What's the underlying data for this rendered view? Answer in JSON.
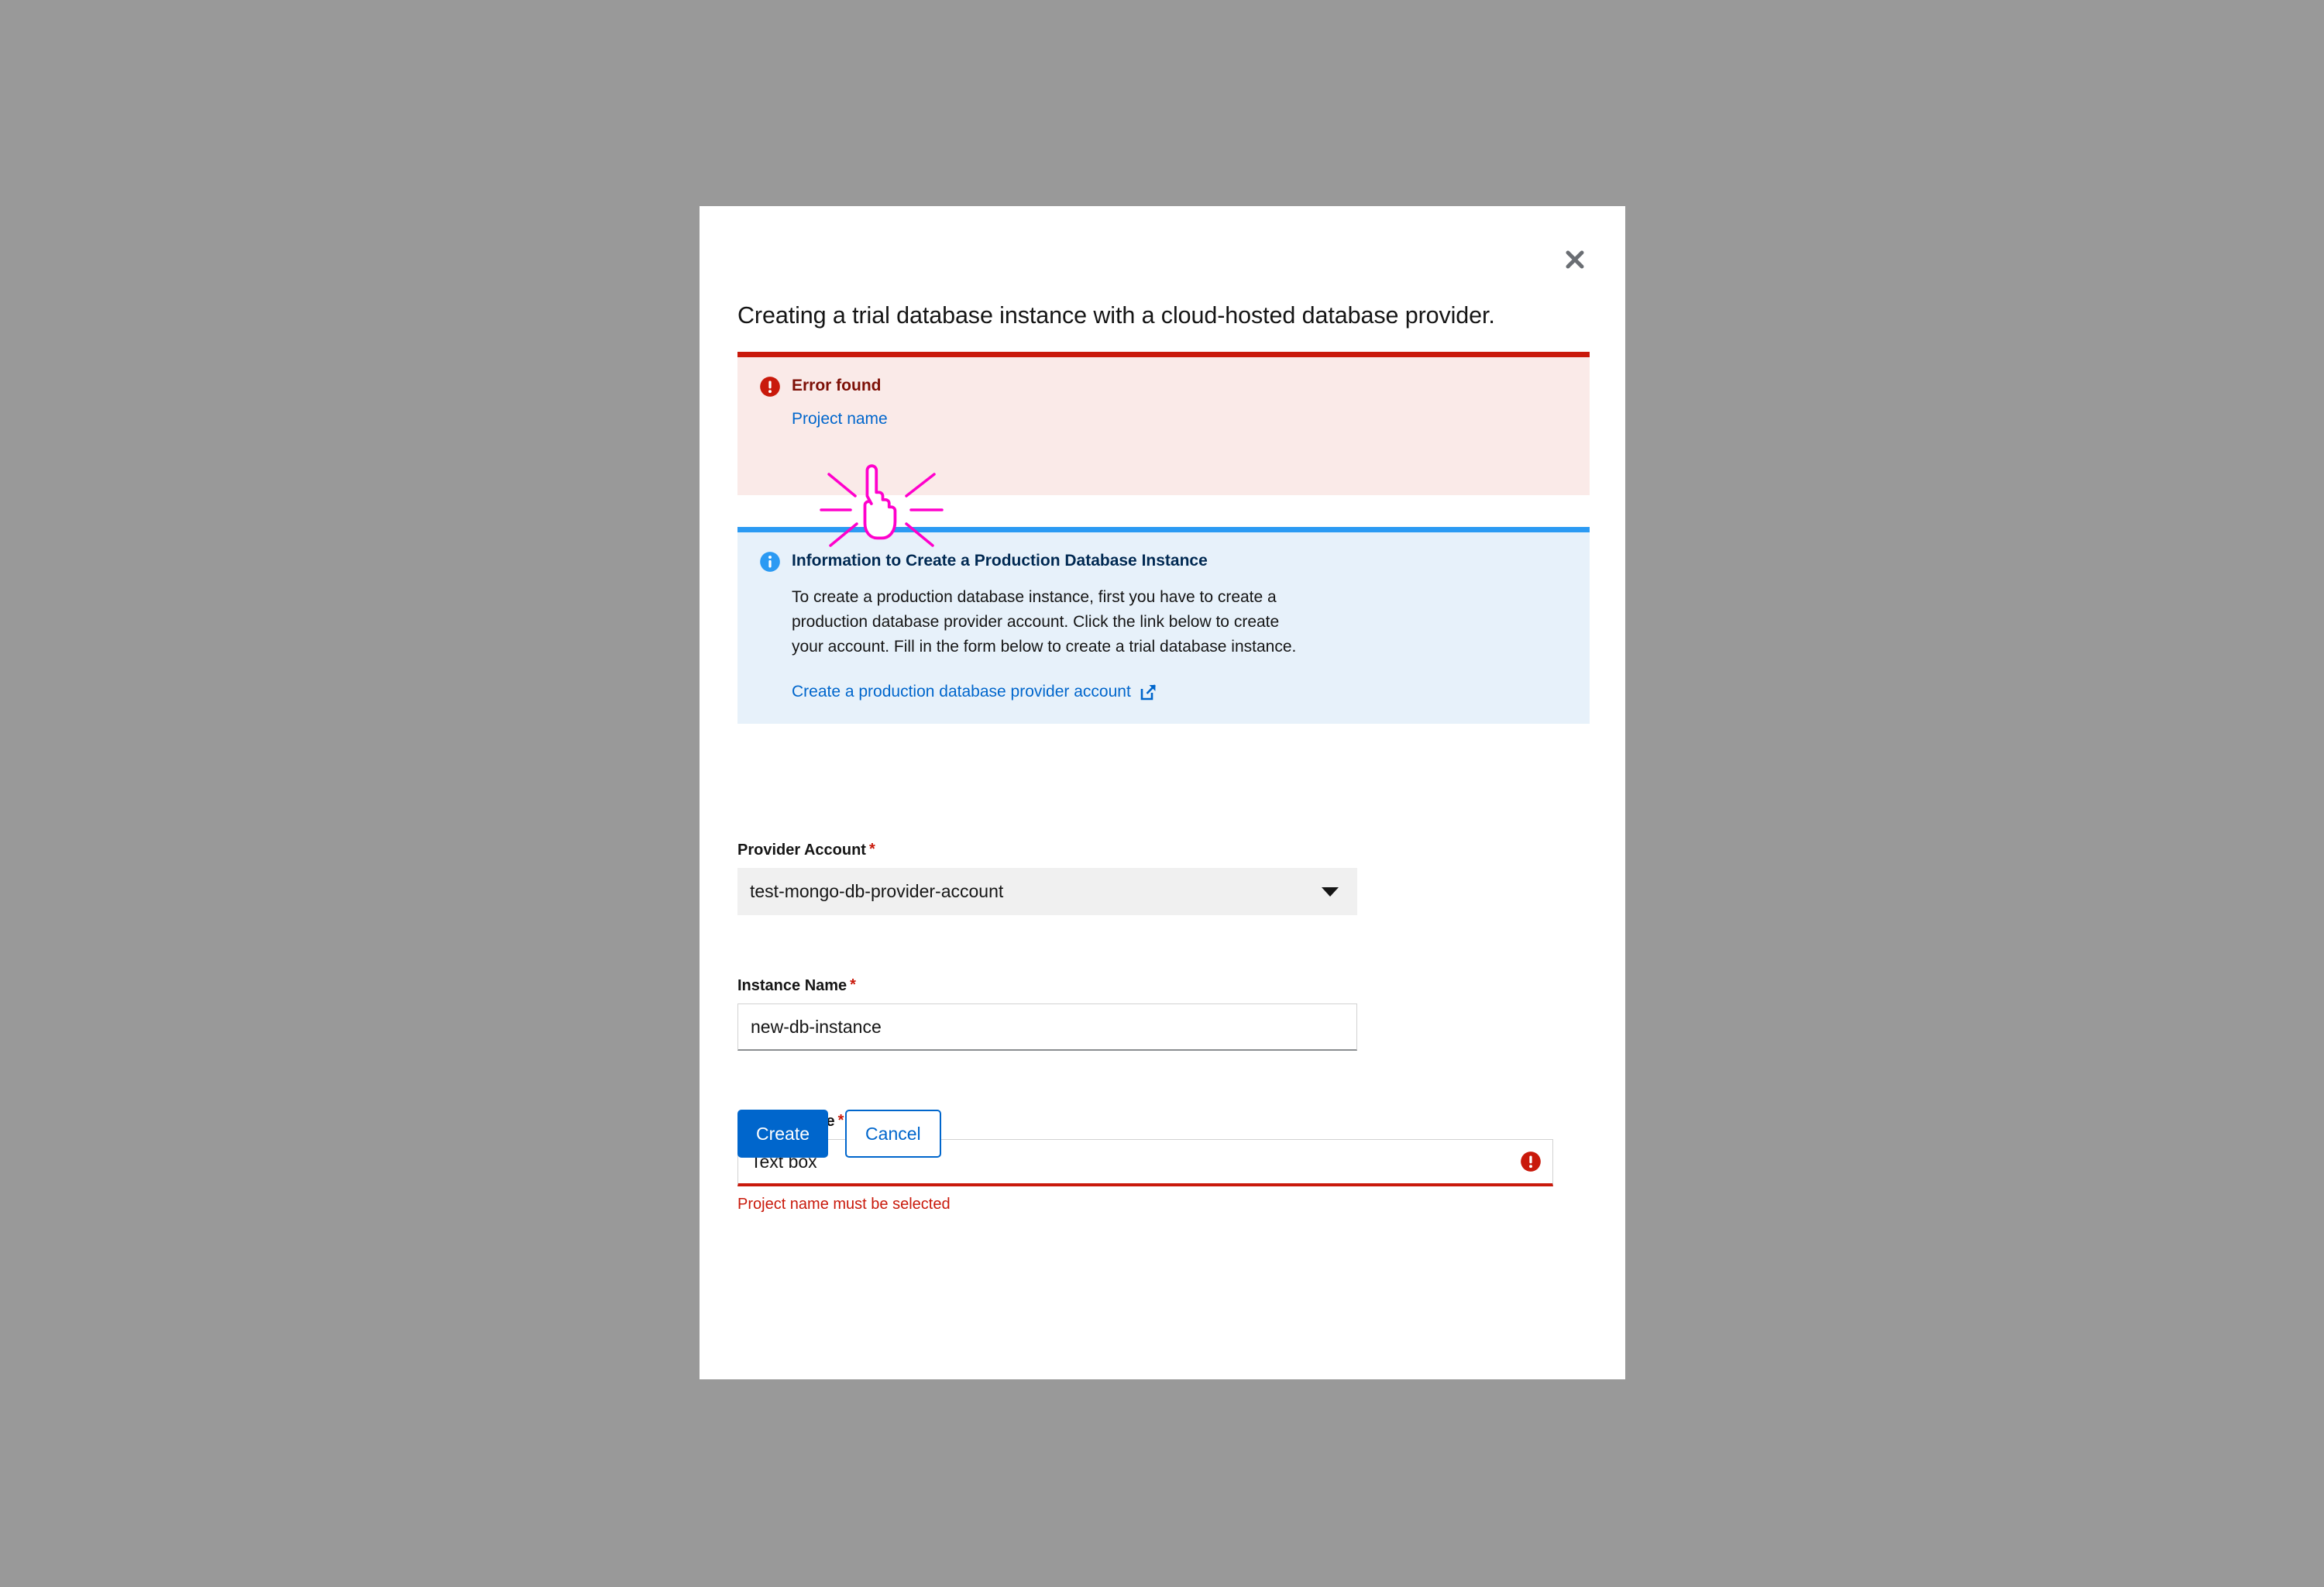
{
  "window": {
    "backdrop_color": "#999999",
    "modal_background": "#ffffff"
  },
  "modal": {
    "title": "Creating a trial database instance with a cloud-hosted database provider.",
    "close_label": "×",
    "close_icon": "close-icon"
  },
  "alerts": {
    "error": {
      "icon": "exclamation-circle-icon",
      "title": "Error found",
      "link_text": "Project name",
      "accent_color": "#c9190b",
      "background_color": "#faeae8"
    },
    "info": {
      "icon": "info-circle-icon",
      "title": "Information to Create a Production Database Instance",
      "body": "To create a production database instance, first you have to create a production database provider account. Click the link below to create your account.  Fill in the form below to create a trial database instance.",
      "link_text": "Create a production database provider account",
      "link_icon": "external-link-icon",
      "accent_color": "#2b9af3",
      "background_color": "#e7f1fa",
      "link_color": "#0066cc"
    }
  },
  "form": {
    "required_marker": "*",
    "provider_account": {
      "label": "Provider Account",
      "value": "test-mongo-db-provider-account",
      "caret_icon": "chevron-down-icon"
    },
    "instance_name": {
      "label": "Instance Name",
      "value": "new-db-instance"
    },
    "project_name": {
      "label": "Project name",
      "value": "Text box",
      "error_icon": "exclamation-circle-icon",
      "error_message": "Project name must be selected",
      "error_color": "#c9190b"
    }
  },
  "actions": {
    "create_label": "Create",
    "cancel_label": "Cancel",
    "primary_color": "#0066cc"
  },
  "cursor": {
    "icon": "pointing-hand-click-cursor",
    "color": "#ff00cc"
  }
}
